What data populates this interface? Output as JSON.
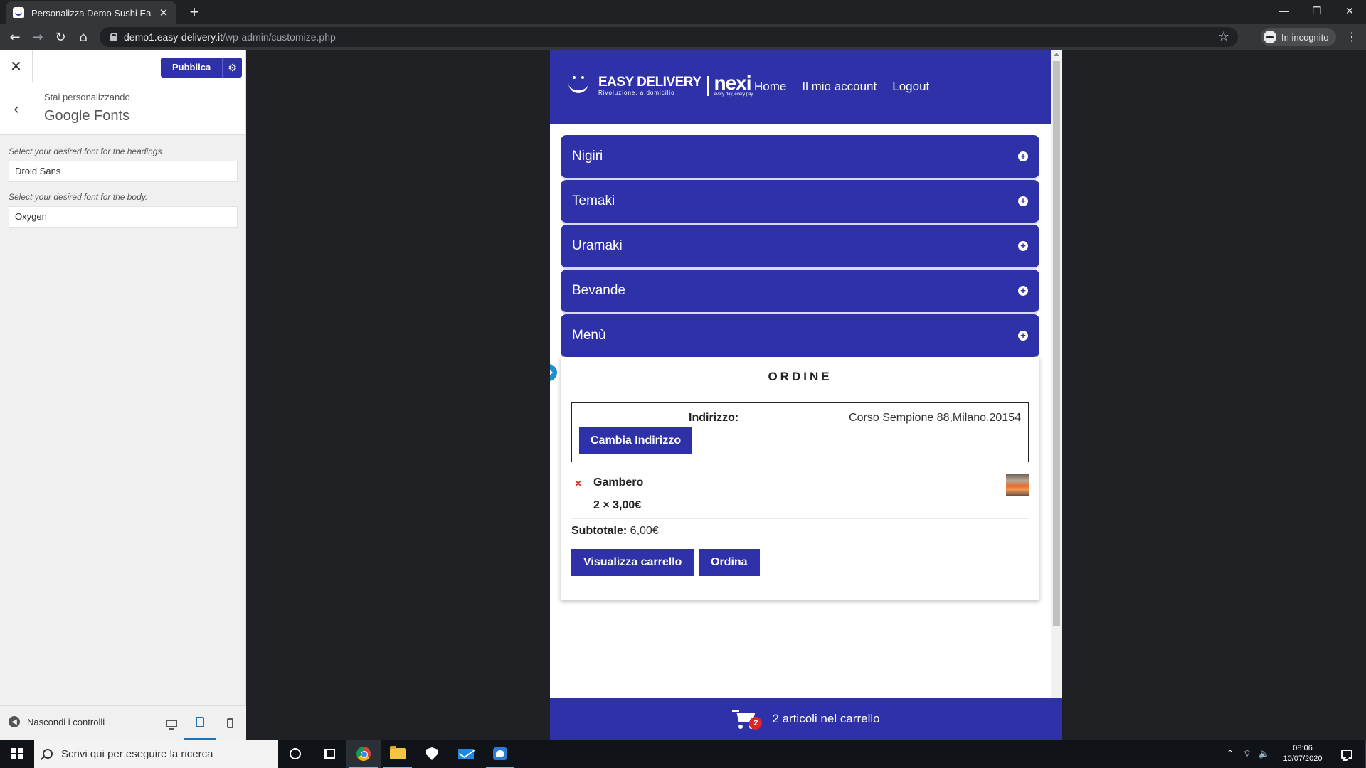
{
  "browser": {
    "tab_title": "Personalizza Demo Sushi Easy De",
    "tab_close": "✕",
    "new_tab": "+",
    "url_host": "demo1.easy-delivery.it",
    "url_path": "/wp-admin/customize.php",
    "incognito_label": "In incognito",
    "icons": [
      "back-icon",
      "forward-icon",
      "reload-icon",
      "home-icon",
      "lock-icon",
      "star-icon",
      "incognito-icon",
      "menu-icon"
    ]
  },
  "customizer": {
    "close": "✕",
    "publish_label": "Pubblica",
    "breadcrumb": "Stai personalizzando",
    "section_title": "Google Fonts",
    "headings_desc": "Select your desired font for the headings.",
    "headings_value": "Droid Sans",
    "body_desc": "Select your desired font for the body.",
    "body_value": "Oxygen",
    "hide_controls": "Nascondi i controlli",
    "active_device": "tablet"
  },
  "site": {
    "logo_name": "EASY DELIVERY",
    "logo_tagline": "Rivoluzione, a domicilio",
    "partner_name": "nexi",
    "partner_tagline": "every day, every pay",
    "nav": [
      "Home",
      "Il mio account",
      "Logout"
    ],
    "categories": [
      "Nigiri",
      "Temaki",
      "Uramaki",
      "Bevande",
      "Menù"
    ],
    "brand_color": "#2e31a8"
  },
  "order": {
    "title": "ORDINE",
    "address_label": "Indirizzo:",
    "address_value": "Corso Sempione 88,Milano,20154",
    "change_address": "Cambia Indirizzo",
    "items": [
      {
        "remove": "×",
        "name": "Gambero",
        "qty_price": "2 × 3,00€"
      }
    ],
    "subtotal_label": "Subtotale:",
    "subtotal_value": "6,00€",
    "view_cart": "Visualizza carrello",
    "checkout": "Ordina"
  },
  "cart_bar": {
    "count": "2",
    "text": "2 articoli nel carrello"
  },
  "taskbar": {
    "search_placeholder": "Scrivi qui per eseguire la ricerca",
    "time": "08:06",
    "date": "10/07/2020"
  }
}
